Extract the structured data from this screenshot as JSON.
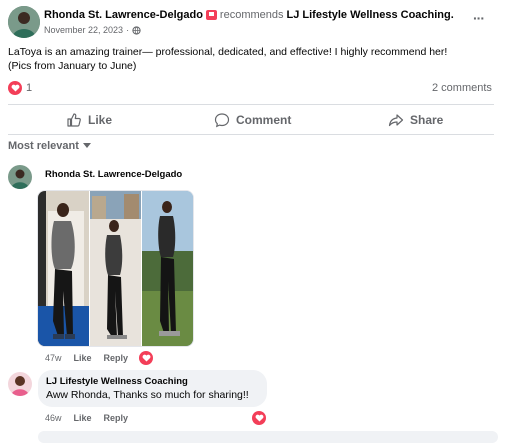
{
  "post": {
    "author": "Rhonda St. Lawrence-Delgado",
    "verb": "recommends",
    "page": "LJ Lifestyle Wellness Coaching.",
    "date": "November 22, 2023",
    "date_separator": "·",
    "more": "···",
    "text_line1": "LaToya is an amazing trainer— professional, dedicated, and effective!  I highly recommend her!",
    "text_line2": "(Pics from January to June)",
    "reaction_count": "1",
    "comments_count": "2 comments"
  },
  "actions": {
    "like": "Like",
    "comment": "Comment",
    "share": "Share"
  },
  "sort": {
    "label": "Most relevant",
    "icon": "caret-down-icon"
  },
  "comments": [
    {
      "author": "Rhonda St. Lawrence-Delgado",
      "age": "47w",
      "like": "Like",
      "reply": "Reply"
    },
    {
      "author": "LJ Lifestyle Wellness Coaching",
      "text": "Aww Rhonda, Thanks so much for sharing!!",
      "age": "46w",
      "like": "Like",
      "reply": "Reply"
    }
  ],
  "colors": {
    "heart": "#f33e58",
    "text": "#050505",
    "muted": "#65676b",
    "divider": "#dadde1",
    "bubble": "#f0f2f5"
  }
}
